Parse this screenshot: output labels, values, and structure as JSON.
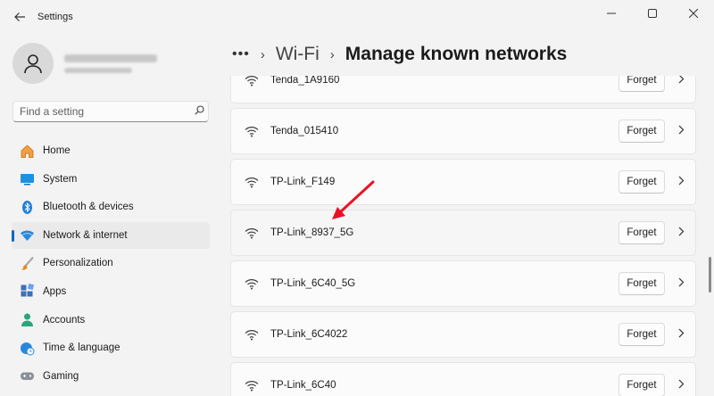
{
  "window": {
    "app_title": "Settings",
    "back_icon": "arrow-left-icon",
    "controls": [
      "minimize-icon",
      "maximize-icon",
      "close-icon"
    ]
  },
  "sidebar": {
    "search_placeholder": "Find a setting",
    "items": [
      {
        "label": "Home",
        "icon": "home-icon",
        "active": false
      },
      {
        "label": "System",
        "icon": "system-icon",
        "active": false
      },
      {
        "label": "Bluetooth & devices",
        "icon": "bluetooth-icon",
        "active": false
      },
      {
        "label": "Network & internet",
        "icon": "network-icon",
        "active": true
      },
      {
        "label": "Personalization",
        "icon": "brush-icon",
        "active": false
      },
      {
        "label": "Apps",
        "icon": "apps-icon",
        "active": false
      },
      {
        "label": "Accounts",
        "icon": "accounts-icon",
        "active": false
      },
      {
        "label": "Time & language",
        "icon": "clock-globe-icon",
        "active": false
      },
      {
        "label": "Gaming",
        "icon": "gamepad-icon",
        "active": false
      }
    ]
  },
  "breadcrumb": {
    "more": "•••",
    "sep": "›",
    "parent": "Wi-Fi",
    "title": "Manage known networks"
  },
  "networks": {
    "forget_label": "Forget",
    "items": [
      {
        "ssid": "Tenda_1A9160"
      },
      {
        "ssid": "Tenda_015410"
      },
      {
        "ssid": "TP-Link_F149"
      },
      {
        "ssid": "TP-Link_8937_5G"
      },
      {
        "ssid": "TP-Link_6C40_5G"
      },
      {
        "ssid": "TP-Link_6C4022"
      },
      {
        "ssid": "TP-Link_6C40"
      }
    ]
  },
  "colors": {
    "accent": "#0067c0",
    "annotation_arrow": "#e81123"
  }
}
